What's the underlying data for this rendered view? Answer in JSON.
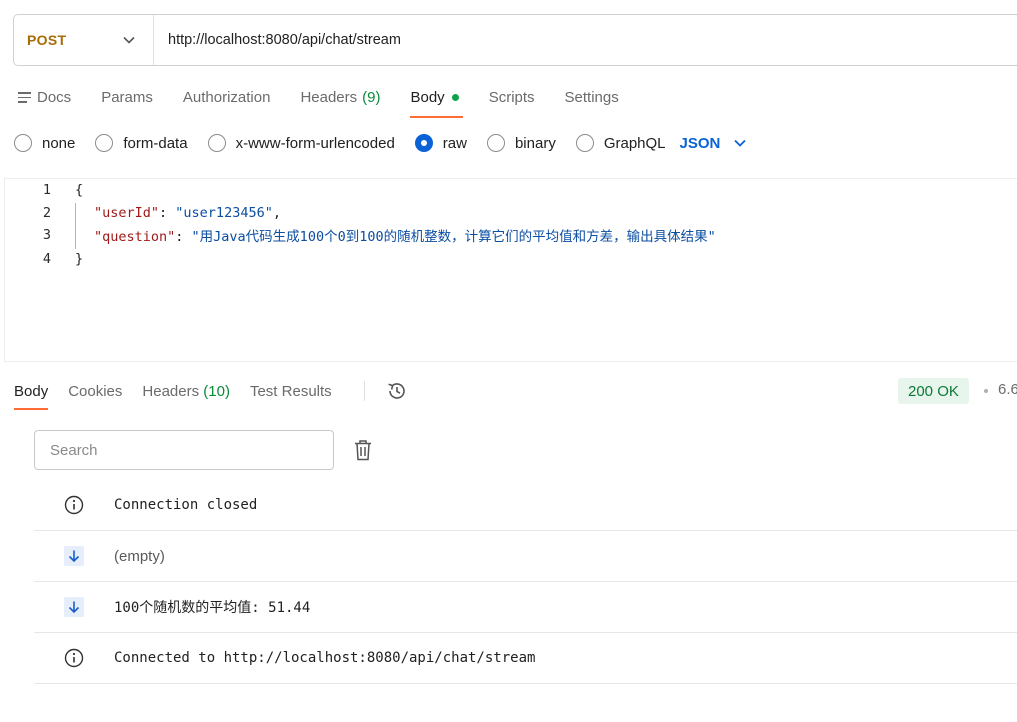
{
  "request": {
    "method": "POST",
    "url": "http://localhost:8080/api/chat/stream"
  },
  "request_tabs": {
    "docs": "Docs",
    "params": "Params",
    "authorization": "Authorization",
    "headers": "Headers",
    "headers_count": "(9)",
    "body": "Body",
    "scripts": "Scripts",
    "settings": "Settings",
    "active": "Body"
  },
  "body_types": {
    "none": "none",
    "form_data": "form-data",
    "urlencoded": "x-www-form-urlencoded",
    "raw": "raw",
    "binary": "binary",
    "graphql": "GraphQL",
    "selected": "raw",
    "language": "JSON"
  },
  "editor": {
    "line_numbers": [
      "1",
      "2",
      "3",
      "4"
    ],
    "open_brace": "{",
    "close_brace": "}",
    "key_user_id": "\"userId\"",
    "value_user_id": "\"user123456\"",
    "key_question": "\"question\"",
    "value_question": "\"用Java代码生成100个0到100的随机整数，计算它们的平均值和方差，输出具体结果\""
  },
  "response_tabs": {
    "body": "Body",
    "cookies": "Cookies",
    "headers": "Headers",
    "headers_count": "(10)",
    "test_results": "Test Results",
    "active": "Body"
  },
  "status": {
    "code": "200 OK",
    "time": "6.6"
  },
  "search": {
    "placeholder": "Search"
  },
  "events": [
    {
      "icon": "info-icon",
      "text": "Connection closed"
    },
    {
      "icon": "arrow-down-icon",
      "text": "(empty)"
    },
    {
      "icon": "arrow-down-icon",
      "text": "100个随机数的平均值: 51.44"
    },
    {
      "icon": "info-icon",
      "text": "Connected to http://localhost:8080/api/chat/stream"
    }
  ],
  "colors": {
    "method": "#a86d05",
    "active_underline": "#ff6c37",
    "accent_blue": "#0a63d6",
    "status_green": "#0b7a35",
    "status_bg": "#e8f5ec"
  }
}
